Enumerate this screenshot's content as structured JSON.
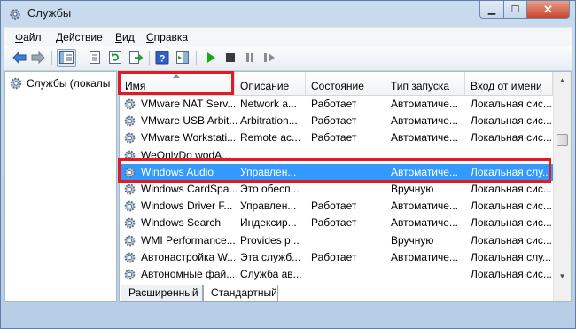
{
  "window": {
    "title": "Службы"
  },
  "menu": [
    "Файл",
    "Действие",
    "Вид",
    "Справка"
  ],
  "menu_accel": [
    "Ф",
    "Д",
    "В",
    "С"
  ],
  "tree": {
    "root": "Службы (локалы"
  },
  "columns": [
    "Имя",
    "Описание",
    "Состояние",
    "Тип запуска",
    "Вход от имени"
  ],
  "rows": [
    {
      "name": "VMware NAT Serv...",
      "desc": "Network a...",
      "state": "Работает",
      "startup": "Автоматиче...",
      "logon": "Локальная сис..."
    },
    {
      "name": "VMware USB Arbit...",
      "desc": "Arbitration...",
      "state": "Работает",
      "startup": "Автоматиче...",
      "logon": "Локальная сис..."
    },
    {
      "name": "VMware Workstati...",
      "desc": "Remote ac...",
      "state": "Работает",
      "startup": "Автоматиче...",
      "logon": "Локальная сис..."
    },
    {
      "name": "WeOnlyDo wodA...",
      "desc": "",
      "state": "",
      "startup": "",
      "logon": ""
    },
    {
      "name": "Windows Audio",
      "desc": "Управлен...",
      "state": "",
      "startup": "Автоматиче...",
      "logon": "Локальная слу..."
    },
    {
      "name": "Windows CardSpa...",
      "desc": "Это обесп...",
      "state": "",
      "startup": "Вручную",
      "logon": "Локальная сис..."
    },
    {
      "name": "Windows Driver F...",
      "desc": "Управлен...",
      "state": "Работает",
      "startup": "Автоматиче...",
      "logon": "Локальная сис..."
    },
    {
      "name": "Windows Search",
      "desc": "Индексир...",
      "state": "Работает",
      "startup": "Автоматиче...",
      "logon": "Локальная сис..."
    },
    {
      "name": "WMI Performance...",
      "desc": "Provides p...",
      "state": "",
      "startup": "Вручную",
      "logon": "Локальная сис..."
    },
    {
      "name": "Автонастройка W...",
      "desc": "Эта служб...",
      "state": "Работает",
      "startup": "Автоматиче...",
      "logon": "Локальная слу..."
    },
    {
      "name": "Автономные фай...",
      "desc": "Служба ав...",
      "state": "",
      "startup": "",
      "logon": "Локальная сис..."
    }
  ],
  "tabs": [
    "Расширенный",
    "Стандартный"
  ],
  "colors": {
    "selection": "#3399ff",
    "highlight": "#e01b24",
    "play": "#1aa51a"
  }
}
